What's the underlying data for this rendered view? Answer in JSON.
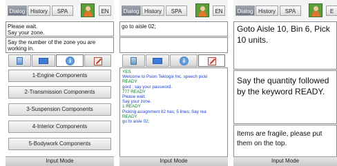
{
  "panels": [
    {
      "tabs": {
        "dialog": "Dialog",
        "history": "History",
        "spa": "SPA"
      },
      "lang": "EN",
      "prompt_lines": [
        "Please wait.",
        "Say your zone."
      ],
      "hint_lines": [
        "Say the number of the zone you are",
        "working in."
      ],
      "menu": [
        "1-Engine Components",
        "2-Transmission Components",
        "3-Suspension Components",
        "4-Interior Components",
        "5-Bodywork Components"
      ],
      "input_mode": "Input Mode"
    },
    {
      "tabs": {
        "dialog": "Dialog",
        "history": "History",
        "spa": "SPA"
      },
      "lang": "EN",
      "prompt_lines": [
        "go to aisle 02;"
      ],
      "history": [
        {
          "text": "YES",
          "color": "#0a7d2a"
        },
        {
          "text": "Welcome to Psion Teklogix Inc. speech picki",
          "color": "#1a3fd0"
        },
        {
          "text": "READY",
          "color": "#0a7d2a"
        },
        {
          "text": "gord ; say your password.",
          "color": "#1a3fd0"
        },
        {
          "text": "777 READY",
          "color": "#0a7d2a"
        },
        {
          "text": "Please wait.",
          "color": "#1a3fd0"
        },
        {
          "text": "Say your zone.",
          "color": "#1a3fd0"
        },
        {
          "text": "1 READY",
          "color": "#0a7d2a"
        },
        {
          "text": "Picking assignment 82 has; 5 lines; Say rea",
          "color": "#1a3fd0"
        },
        {
          "text": "READY",
          "color": "#0a7d2a"
        },
        {
          "text": "go to aisle 02;",
          "color": "#1a3fd0"
        }
      ],
      "input_mode": "Input Mode"
    },
    {
      "tabs": {
        "dialog": "Dialog",
        "history": "History",
        "spa": "SPA"
      },
      "lang": "E",
      "instruction_lines": [
        "Goto Aisle 10, Bin 6, Pick",
        "10 units."
      ],
      "hint_lines": [
        "Say the quantity followed",
        "by the keyword READY."
      ],
      "note_lines": [
        "Items are fragile, please put",
        "them on the top."
      ],
      "input_mode": "Input Mode"
    }
  ]
}
